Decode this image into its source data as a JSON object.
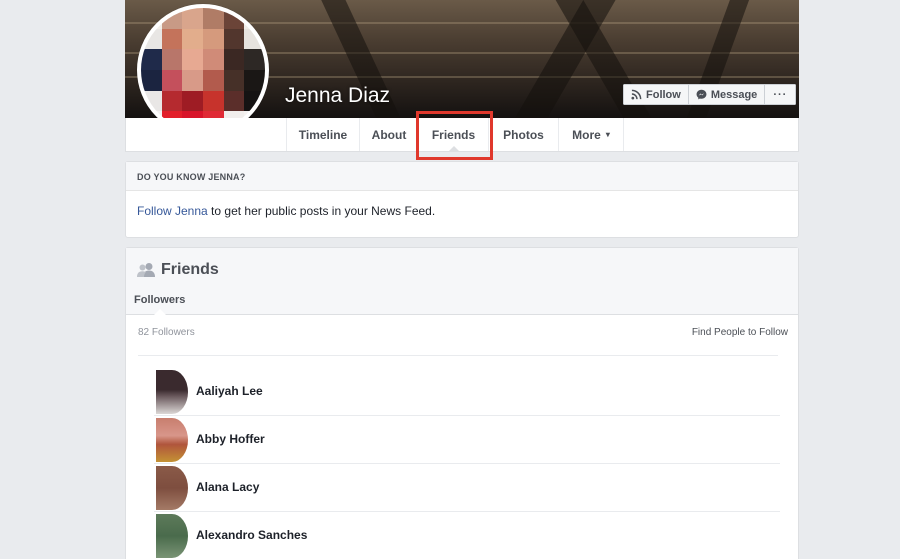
{
  "profile": {
    "name": "Jenna Diaz"
  },
  "cover_actions": {
    "follow_label": "Follow",
    "message_label": "Message",
    "more_label": "···"
  },
  "tabs": [
    {
      "label": "Timeline"
    },
    {
      "label": "About"
    },
    {
      "label": "Friends",
      "active": true
    },
    {
      "label": "Photos"
    },
    {
      "label": "More",
      "caret": "▾"
    }
  ],
  "know_card": {
    "heading": "DO YOU KNOW JENNA?",
    "link_text": "Follow Jenna",
    "rest_text": " to get her public posts in your News Feed."
  },
  "friends_card": {
    "title": "Friends",
    "subtab": "Followers",
    "count_text": "82 Followers",
    "find_link": "Find People to Follow",
    "people": [
      {
        "name": "Aaliyah Lee"
      },
      {
        "name": "Abby Hoffer"
      },
      {
        "name": "Alana Lacy"
      },
      {
        "name": "Alexandro Sanches"
      }
    ]
  },
  "colors": {
    "link": "#365899",
    "highlight": "#e0382c",
    "background": "#e9ebee"
  }
}
